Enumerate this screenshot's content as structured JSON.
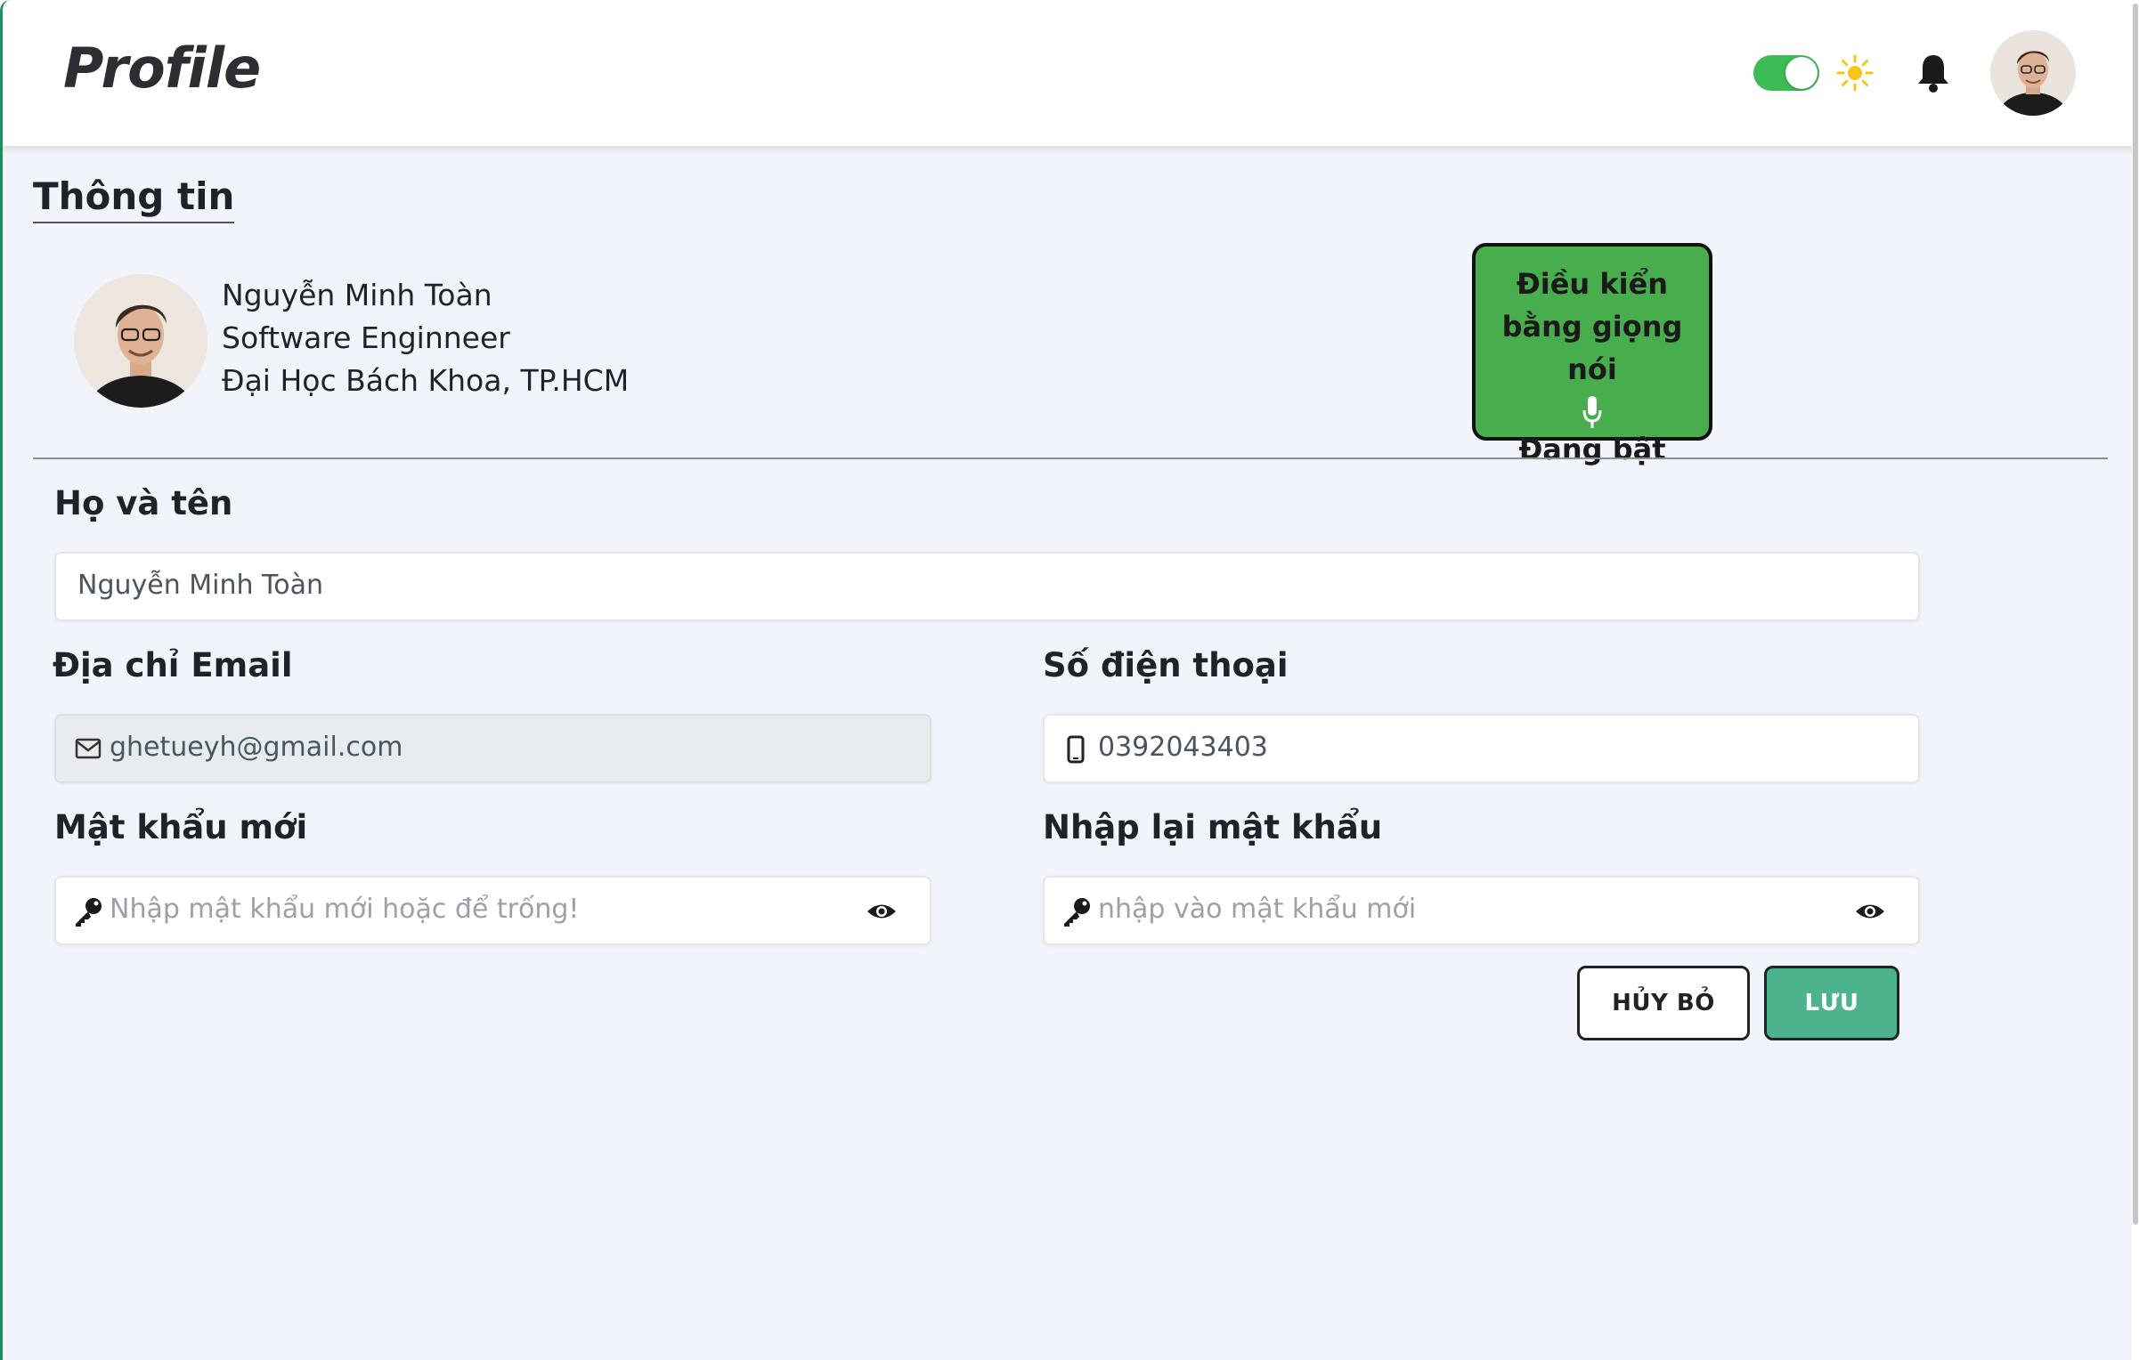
{
  "header": {
    "title": "Profile",
    "theme_toggle_on": true
  },
  "info_section": {
    "title": "Thông tin",
    "name": "Nguyễn Minh Toàn",
    "job": "Software Enginneer",
    "school": "Đại Học Bách Khoa, TP.HCM"
  },
  "voice_control": {
    "title": "Điều kiển bằng giọng nói",
    "status": "Đang bật",
    "color": "#48ad4d"
  },
  "form": {
    "fullname": {
      "label": "Họ và tên",
      "value": "Nguyễn Minh Toàn"
    },
    "email": {
      "label": "Địa chỉ Email",
      "value": "ghetueyh@gmail.com",
      "icon": "mail-icon"
    },
    "phone": {
      "label": "Số điện thoại",
      "value": "0392043403",
      "icon": "phone-icon"
    },
    "new_password": {
      "label": "Mật khẩu mới",
      "placeholder": "Nhập mật khẩu mới hoặc để trống!",
      "icon": "key-icon"
    },
    "confirm_password": {
      "label": "Nhập lại mật khẩu",
      "placeholder": "nhập vào mật khẩu mới",
      "icon": "key-icon"
    }
  },
  "actions": {
    "cancel_label": "HỦY BỎ",
    "save_label": "LƯU",
    "save_color": "#4cb38c"
  }
}
